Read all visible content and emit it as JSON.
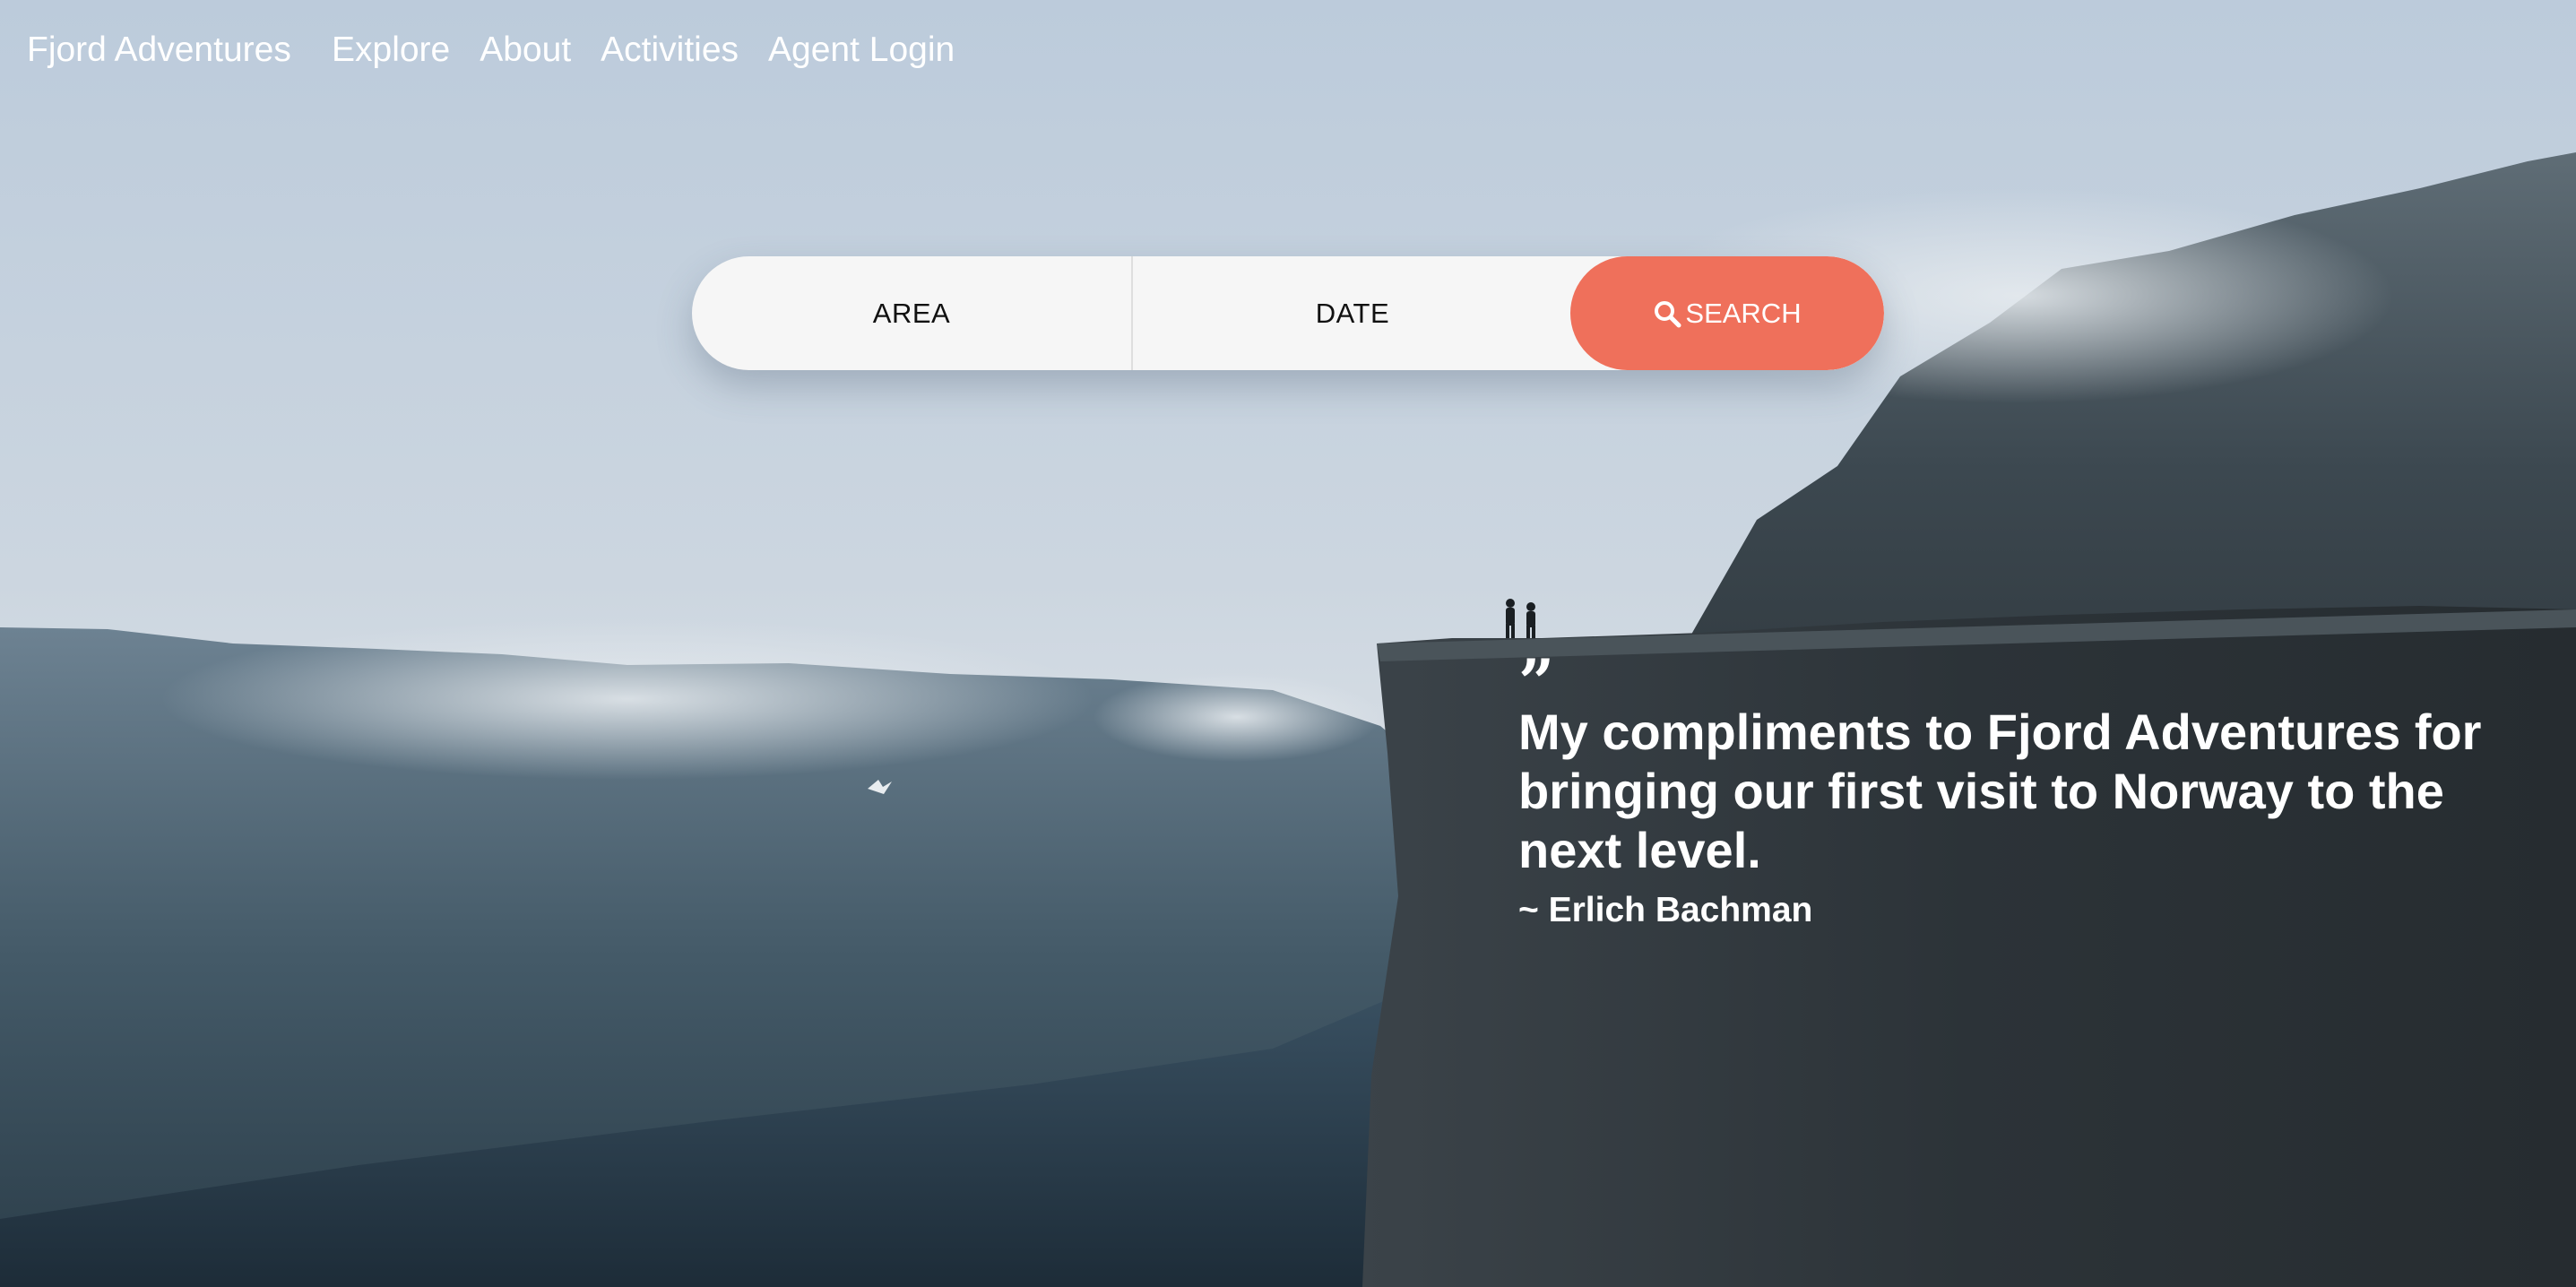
{
  "nav": {
    "brand": "Fjord Adventures",
    "links": [
      "Explore",
      "About",
      "Activities",
      "Agent Login"
    ]
  },
  "search": {
    "area_label": "AREA",
    "date_label": "DATE",
    "button_label": "SEARCH",
    "button_icon": "search-icon"
  },
  "testimonial": {
    "mark": "”",
    "quote": "My compliments to Fjord Adventures for bringing our first visit to Norway to the next level.",
    "author": "~ Erlich Bachman"
  },
  "colors": {
    "accent": "#ef705b",
    "search_bg": "#f6f6f6",
    "text_light": "#ffffff"
  }
}
